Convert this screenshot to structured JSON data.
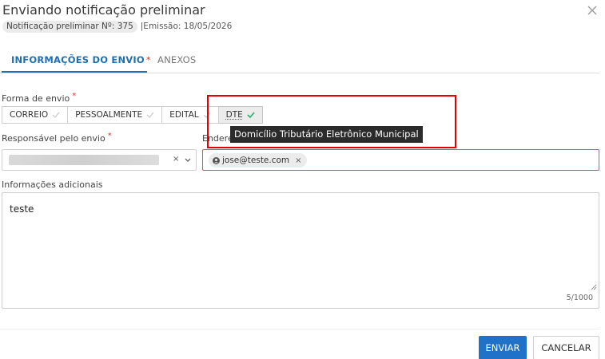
{
  "dialog": {
    "title": "Enviando notificação preliminar",
    "badge": "Notificação preliminar Nº: 375",
    "emission": "|Emissão: 18/05/2026"
  },
  "tabs": [
    {
      "label": "INFORMAÇÕES DO ENVIO",
      "required_mark": "*",
      "active": true
    },
    {
      "label": "ANEXOS",
      "active": false
    }
  ],
  "form": {
    "forma_envio": {
      "label": "Forma de envio",
      "required_mark": "*",
      "options": [
        {
          "label": "CORREIO",
          "selected": false
        },
        {
          "label": "PESSOALMENTE",
          "selected": false
        },
        {
          "label": "EDITAL",
          "selected": false
        },
        {
          "label": "DTE",
          "selected": true
        }
      ],
      "tooltip": "Domicílio Tributário Eletrônico Municipal"
    },
    "responsavel": {
      "label": "Responsável pelo envio",
      "required_mark": "*",
      "clear": "×"
    },
    "endereco": {
      "label": "Endereço eletrônico",
      "chip": "jose@teste.com",
      "chip_remove": "×"
    },
    "info": {
      "label": "Informações adicionais",
      "value": "teste",
      "counter": "5/1000"
    }
  },
  "actions": {
    "send": "ENVIAR",
    "cancel": "CANCELAR"
  },
  "colors": {
    "primary": "#1f72c7",
    "tab_active": "#1f6fb2",
    "required": "#d9362b",
    "highlight": "#e00000",
    "check": "#2eae6a"
  }
}
